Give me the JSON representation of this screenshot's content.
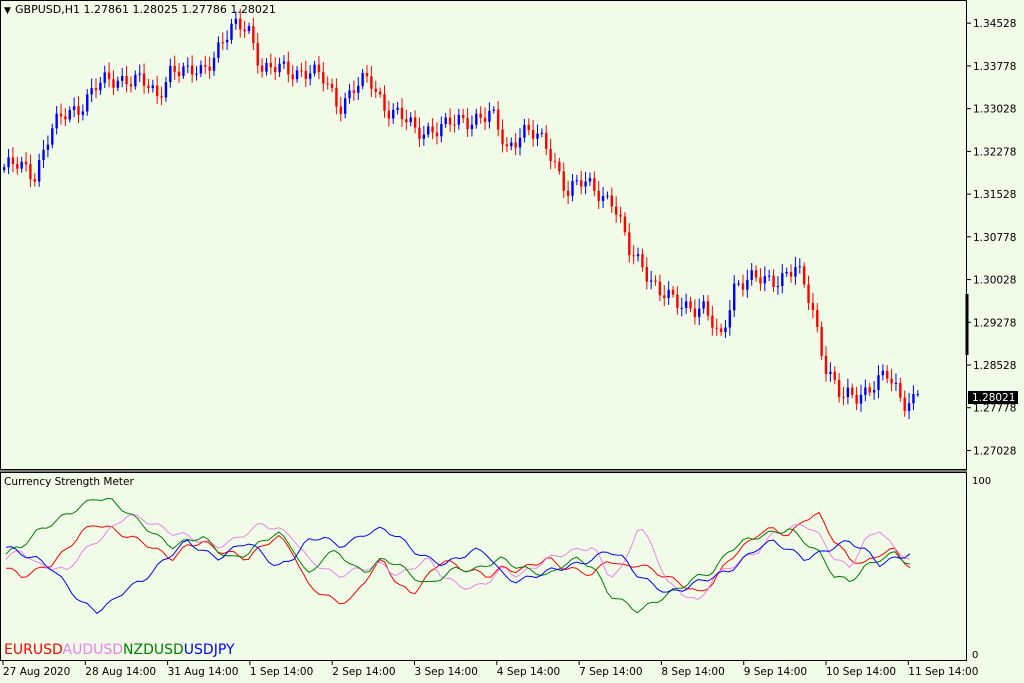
{
  "main_panel": {
    "dropdown_marker": "▼",
    "header": "GBPUSD,H1  1.27861 1.28025 1.27786 1.28021",
    "current_price_label": "1.28021",
    "current_price": 1.28021,
    "price_ticks": [
      "1.34528",
      "1.33778",
      "1.33028",
      "1.32278",
      "1.31528",
      "1.30778",
      "1.30028",
      "1.29278",
      "1.28528",
      "1.27778",
      "1.27028"
    ],
    "colors": {
      "bull": "#0000ff",
      "bear": "#ff0000",
      "background": "#f0fbe8",
      "grid_frame": "#000000"
    }
  },
  "indicator_panel": {
    "title": "Currency Strength Meter",
    "scale_max_label": "100",
    "scale_min_label": "0",
    "legend": [
      {
        "label": "EURUSD",
        "color": "#ff0000"
      },
      {
        "label": "AUDUSD",
        "color": "#ee82ee"
      },
      {
        "label": "NZDUSD",
        "color": "#008000"
      },
      {
        "label": "USDJPY",
        "color": "#0000ff"
      }
    ]
  },
  "time_axis": {
    "labels": [
      "27 Aug 2020",
      "28 Aug 14:00",
      "31 Aug 14:00",
      "1 Sep 14:00",
      "2 Sep 14:00",
      "3 Sep 14:00",
      "4 Sep 14:00",
      "7 Sep 14:00",
      "8 Sep 14:00",
      "9 Sep 14:00",
      "10 Sep 14:00",
      "11 Sep 14:00"
    ]
  },
  "chart_data": [
    {
      "type": "candlestick",
      "symbol": "GBPUSD",
      "timeframe": "H1",
      "last_bar": {
        "open": 1.27861,
        "high": 1.28025,
        "low": 1.27786,
        "close": 1.28021
      },
      "y_range": [
        1.2672,
        1.349
      ],
      "x_categories": [
        "27 Aug",
        "28 Aug",
        "31 Aug",
        "1 Sep",
        "2 Sep",
        "3 Sep",
        "4 Sep",
        "7 Sep",
        "8 Sep",
        "9 Sep",
        "10 Sep",
        "11 Sep"
      ],
      "close_path": [
        [
          0,
          1.32
        ],
        [
          1,
          1.32
        ],
        [
          2,
          1.319
        ],
        [
          3,
          1.326
        ],
        [
          4,
          1.329
        ],
        [
          5,
          1.331
        ],
        [
          6,
          1.334
        ],
        [
          7,
          1.335
        ],
        [
          8,
          1.336
        ],
        [
          9,
          1.335
        ],
        [
          10,
          1.332
        ],
        [
          11,
          1.338
        ],
        [
          12,
          1.336
        ],
        [
          13,
          1.337
        ],
        [
          14,
          1.341
        ],
        [
          15,
          1.344
        ],
        [
          16,
          1.345
        ],
        [
          17,
          1.337
        ],
        [
          18,
          1.337
        ],
        [
          19,
          1.337
        ],
        [
          20,
          1.337
        ],
        [
          21,
          1.335
        ],
        [
          22,
          1.331
        ],
        [
          23,
          1.334
        ],
        [
          24,
          1.335
        ],
        [
          25,
          1.331
        ],
        [
          26,
          1.329
        ],
        [
          27,
          1.326
        ],
        [
          28,
          1.327
        ],
        [
          29,
          1.327
        ],
        [
          30,
          1.328
        ],
        [
          31,
          1.329
        ],
        [
          32,
          1.329
        ],
        [
          33,
          1.323
        ],
        [
          34,
          1.327
        ],
        [
          35,
          1.325
        ],
        [
          36,
          1.322
        ],
        [
          37,
          1.316
        ],
        [
          38,
          1.317
        ],
        [
          39,
          1.316
        ],
        [
          40,
          1.314
        ],
        [
          41,
          1.305
        ],
        [
          42,
          1.303
        ],
        [
          43,
          1.298
        ],
        [
          44,
          1.296
        ],
        [
          45,
          1.296
        ],
        [
          46,
          1.295
        ],
        [
          47,
          1.289
        ],
        [
          48,
          1.3
        ],
        [
          49,
          1.3
        ],
        [
          50,
          1.3
        ],
        [
          51,
          1.301
        ],
        [
          52,
          1.302
        ],
        [
          53,
          1.296
        ],
        [
          54,
          1.285
        ],
        [
          55,
          1.279
        ],
        [
          56,
          1.28
        ],
        [
          57,
          1.282
        ],
        [
          58,
          1.283
        ],
        [
          59,
          1.279
        ],
        [
          60,
          1.28
        ]
      ]
    },
    {
      "type": "line",
      "title": "Currency Strength Meter",
      "ylim": [
        0,
        100
      ],
      "x": [
        0,
        1,
        2,
        3,
        4,
        5,
        6,
        7,
        8,
        9,
        10,
        11,
        12,
        13,
        14,
        15,
        16,
        17,
        18,
        19,
        20,
        21,
        22,
        23,
        24,
        25,
        26,
        27,
        28,
        29,
        30,
        31,
        32,
        33,
        34,
        35,
        36,
        37,
        38,
        39,
        40,
        41,
        42,
        43,
        44,
        45,
        46,
        47,
        48,
        49,
        50,
        51,
        52,
        53,
        54,
        55,
        56,
        57,
        58,
        59,
        60
      ],
      "series": [
        {
          "name": "EURUSD",
          "color": "#ff0000",
          "values": [
            50,
            45,
            48,
            52,
            60,
            70,
            75,
            72,
            68,
            65,
            60,
            55,
            62,
            65,
            60,
            58,
            55,
            62,
            68,
            60,
            40,
            35,
            30,
            32,
            45,
            55,
            40,
            35,
            45,
            55,
            50,
            48,
            45,
            50,
            48,
            52,
            55,
            50,
            48,
            46,
            55,
            50,
            52,
            48,
            44,
            40,
            35,
            42,
            55,
            62,
            70,
            72,
            68,
            78,
            80,
            65,
            55,
            52,
            58,
            60,
            50
          ]
        },
        {
          "name": "AUDUSD",
          "color": "#ee82ee",
          "values": [
            55,
            60,
            52,
            50,
            48,
            58,
            65,
            72,
            80,
            78,
            74,
            70,
            68,
            65,
            62,
            65,
            70,
            75,
            72,
            68,
            55,
            50,
            45,
            48,
            50,
            52,
            45,
            50,
            55,
            45,
            40,
            38,
            42,
            50,
            45,
            50,
            55,
            58,
            60,
            62,
            45,
            50,
            75,
            60,
            40,
            35,
            30,
            45,
            50,
            55,
            60,
            70,
            72,
            75,
            68,
            55,
            50,
            65,
            72,
            60,
            55
          ]
        },
        {
          "name": "NZDUSD",
          "color": "#008000",
          "values": [
            58,
            62,
            70,
            75,
            80,
            85,
            90,
            88,
            82,
            75,
            68,
            62,
            65,
            68,
            60,
            55,
            58,
            65,
            70,
            62,
            45,
            55,
            60,
            50,
            48,
            55,
            52,
            45,
            40,
            45,
            50,
            48,
            52,
            55,
            50,
            48,
            45,
            52,
            55,
            50,
            35,
            30,
            25,
            30,
            35,
            40,
            45,
            48,
            60,
            65,
            68,
            70,
            72,
            65,
            58,
            45,
            42,
            50,
            55,
            58,
            52
          ]
        },
        {
          "name": "USDJPY",
          "color": "#0000ff",
          "values": [
            62,
            58,
            55,
            50,
            40,
            30,
            25,
            30,
            38,
            42,
            50,
            58,
            65,
            60,
            55,
            60,
            65,
            58,
            50,
            55,
            65,
            68,
            62,
            65,
            70,
            72,
            68,
            60,
            55,
            52,
            55,
            60,
            58,
            45,
            42,
            45,
            48,
            50,
            52,
            55,
            60,
            55,
            45,
            40,
            35,
            38,
            42,
            45,
            48,
            55,
            62,
            65,
            60,
            55,
            58,
            62,
            65,
            60,
            52,
            55,
            58
          ]
        }
      ]
    }
  ]
}
